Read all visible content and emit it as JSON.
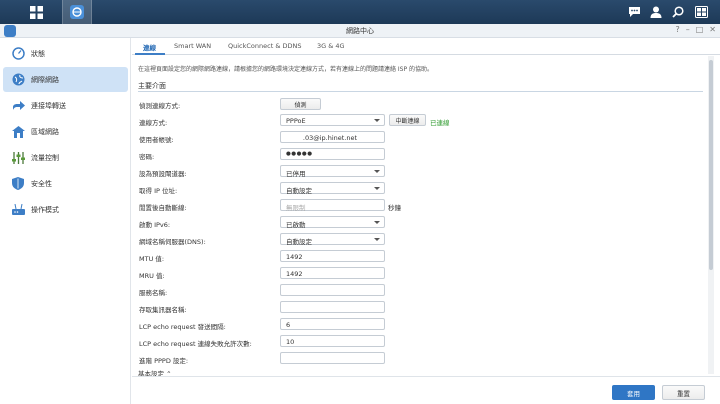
{
  "window": {
    "title": "網路中心",
    "controls": [
      "?",
      "–",
      "□",
      "✕"
    ]
  },
  "sidebar": {
    "items": [
      {
        "label": "狀態",
        "icon": "gauge-icon"
      },
      {
        "label": "網際網路",
        "icon": "globe-icon",
        "active": true
      },
      {
        "label": "連接埠轉送",
        "icon": "forward-arrow-icon"
      },
      {
        "label": "區域網路",
        "icon": "home-network-icon"
      },
      {
        "label": "流量控制",
        "icon": "sliders-icon"
      },
      {
        "label": "安全性",
        "icon": "shield-icon"
      },
      {
        "label": "操作模式",
        "icon": "router-icon"
      }
    ]
  },
  "tabs": [
    {
      "label": "連線",
      "active": true
    },
    {
      "label": "Smart WAN"
    },
    {
      "label": "QuickConnect & DDNS"
    },
    {
      "label": "3G & 4G"
    }
  ],
  "main": {
    "description": "在這裡頁面設定您的網際網路連線，請根據您的網路環境決定連線方式，若有連線上的問題請連絡 ISP 的協助。",
    "section_title": "主要介面",
    "detect_button": "偵測",
    "disconnect_button": "中斷連線",
    "status": "已連線",
    "unit_seconds": "秒鐘",
    "fields": [
      {
        "label": "偵測連線方式:"
      },
      {
        "label": "連線方式:",
        "value": "PPPoE",
        "type": "select"
      },
      {
        "label": "使用者帳號:",
        "value": "        .03@ip.hinet.net",
        "type": "text"
      },
      {
        "label": "密碼:",
        "value": "●●●●●",
        "type": "password"
      },
      {
        "label": "設為預設閘道器:",
        "value": "已停用",
        "type": "select"
      },
      {
        "label": "取得 IP 位址:",
        "value": "自動設定",
        "type": "select"
      },
      {
        "label": "閒置後自動斷線:",
        "value": "無限制",
        "type": "text",
        "placeholder": true
      },
      {
        "label": "啟動 IPv6:",
        "value": "已啟動",
        "type": "select"
      },
      {
        "label": "網域名稱伺服器(DNS):",
        "value": "自動設定",
        "type": "select"
      },
      {
        "label": "MTU 值:",
        "value": "1492",
        "type": "text"
      },
      {
        "label": "MRU 值:",
        "value": "1492",
        "type": "text"
      },
      {
        "label": "服務名稱:",
        "value": "",
        "type": "text"
      },
      {
        "label": "存取集訊器名稱:",
        "value": "",
        "type": "text"
      },
      {
        "label": "LCP echo request 發送間隔:",
        "value": "6",
        "type": "text"
      },
      {
        "label": "LCP echo request 連線失敗允許次數:",
        "value": "10",
        "type": "text"
      },
      {
        "label": "進階 PPPD 設定:",
        "value": "",
        "type": "text"
      }
    ],
    "basic_settings": "基本設定 ⌃"
  },
  "footer": {
    "apply": "套用",
    "reset": "重置"
  },
  "colors": {
    "taskbar": "#1d3957",
    "accent": "#2f76c5",
    "active_nav": "#cfe2f6",
    "connected": "#2d9a2d"
  }
}
